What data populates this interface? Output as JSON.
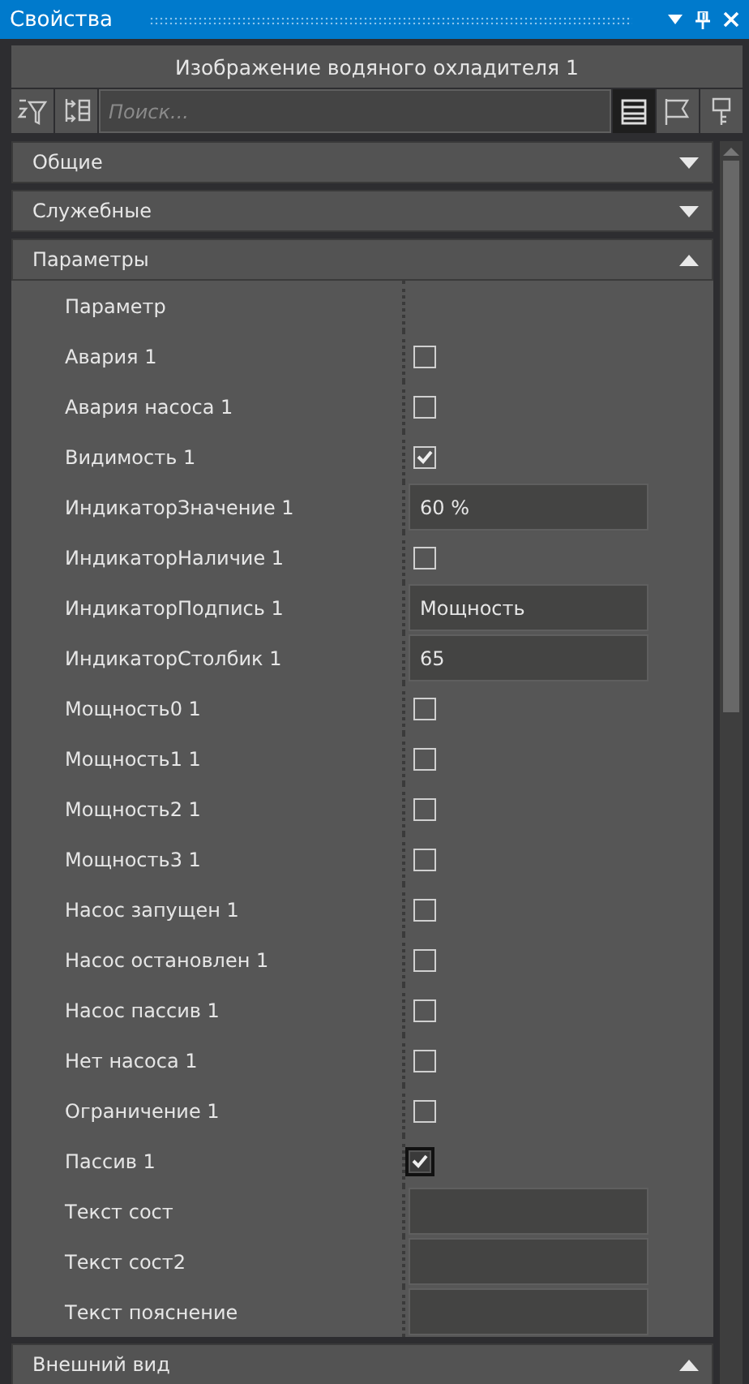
{
  "window": {
    "title": "Свойства"
  },
  "object_title": "Изображение водяного охладителя 1",
  "toolbar": {
    "left_buttons": [
      {
        "kind": "sort-filter",
        "selected": false
      },
      {
        "kind": "tree",
        "selected": false
      }
    ],
    "search": {
      "placeholder": "Поиск..."
    },
    "right_buttons": [
      {
        "kind": "list",
        "selected": true
      },
      {
        "kind": "flag",
        "selected": false
      },
      {
        "kind": "key",
        "selected": false
      }
    ]
  },
  "sections": [
    {
      "title": "Общие",
      "expanded": false
    },
    {
      "title": "Служебные",
      "expanded": false
    },
    {
      "title": "Параметры",
      "expanded": true,
      "rows": [
        {
          "kind": "header",
          "label": "Параметр"
        },
        {
          "kind": "checkbox",
          "label": "Авария 1",
          "checked": false,
          "focused": false
        },
        {
          "kind": "checkbox",
          "label": "Авария насоса 1",
          "checked": false,
          "focused": false
        },
        {
          "kind": "checkbox",
          "label": "Видимость 1",
          "checked": true,
          "focused": false
        },
        {
          "kind": "text",
          "label": "ИндикаторЗначение 1",
          "value": "60 %"
        },
        {
          "kind": "checkbox",
          "label": "ИндикаторНаличие 1",
          "checked": false,
          "focused": false
        },
        {
          "kind": "text",
          "label": "ИндикаторПодпись 1",
          "value": "Мощность"
        },
        {
          "kind": "text",
          "label": "ИндикаторСтолбик 1",
          "value": "65"
        },
        {
          "kind": "checkbox",
          "label": "Мощность0 1",
          "checked": false,
          "focused": false
        },
        {
          "kind": "checkbox",
          "label": "Мощность1 1",
          "checked": false,
          "focused": false
        },
        {
          "kind": "checkbox",
          "label": "Мощность2 1",
          "checked": false,
          "focused": false
        },
        {
          "kind": "checkbox",
          "label": "Мощность3 1",
          "checked": false,
          "focused": false
        },
        {
          "kind": "checkbox",
          "label": "Насос запущен 1",
          "checked": false,
          "focused": false
        },
        {
          "kind": "checkbox",
          "label": "Насос остановлен 1",
          "checked": false,
          "focused": false
        },
        {
          "kind": "checkbox",
          "label": "Насос пассив 1",
          "checked": false,
          "focused": false
        },
        {
          "kind": "checkbox",
          "label": "Нет насоса 1",
          "checked": false,
          "focused": false
        },
        {
          "kind": "checkbox",
          "label": "Ограничение 1",
          "checked": false,
          "focused": false
        },
        {
          "kind": "checkbox",
          "label": "Пассив 1",
          "checked": true,
          "focused": true
        },
        {
          "kind": "text",
          "label": "Текст сост",
          "value": ""
        },
        {
          "kind": "text",
          "label": "Текст сост2",
          "value": ""
        },
        {
          "kind": "text",
          "label": "Текст пояснение",
          "value": ""
        }
      ]
    },
    {
      "title": "Внешний вид",
      "expanded": true
    }
  ]
}
